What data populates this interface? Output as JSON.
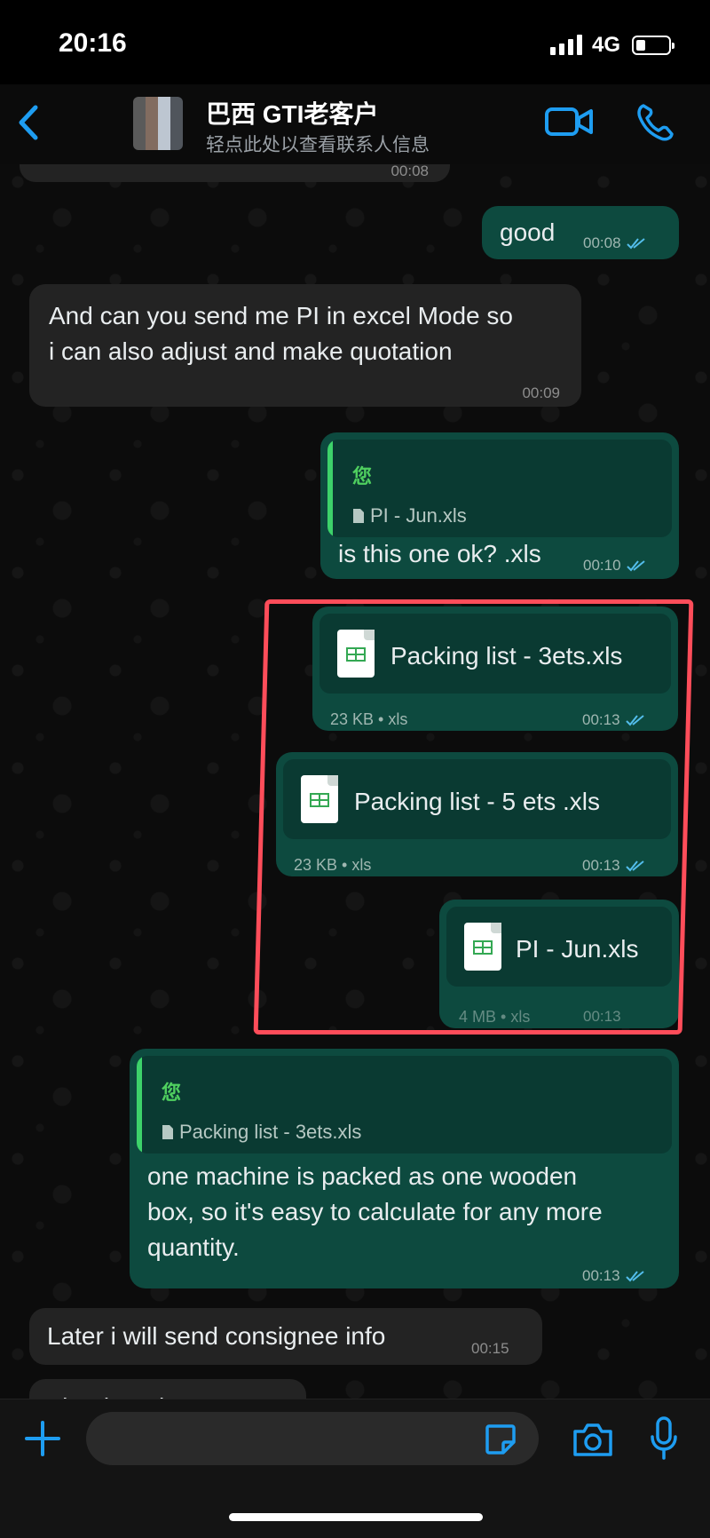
{
  "status": {
    "time": "20:16",
    "network": "4G"
  },
  "header": {
    "contact_name": "巴西 GTI老客户",
    "subtitle": "轻点此处以查看联系人信息"
  },
  "messages": {
    "m0": {
      "time": "00:08"
    },
    "m1": {
      "text": "good",
      "time": "00:08"
    },
    "m2": {
      "line1": "And can you send me PI in excel Mode so",
      "line2": "i can also adjust and make quotation",
      "time": "00:09"
    },
    "m3": {
      "quote_author": "您",
      "quote_file": "PI - Jun.xls",
      "text": "is this one ok? .xls",
      "time": "00:10"
    },
    "m4": {
      "filename": "Packing list - 3ets.xls",
      "size": "23 KB • xls",
      "time": "00:13"
    },
    "m5": {
      "filename": "Packing list - 5 ets .xls",
      "size": "23 KB • xls",
      "time": "00:13"
    },
    "m6": {
      "filename": "PI - Jun.xls",
      "size": "4 MB • xls",
      "time": "00:13"
    },
    "m7": {
      "quote_author": "您",
      "quote_file": "Packing list - 3ets.xls",
      "line1": "one machine is packed as one wooden",
      "line2": "box, so it's easy to calculate for any more",
      "line3": "quantity.",
      "time": "00:13"
    },
    "m8": {
      "text": "Later i will send consignee info",
      "time": "00:15"
    },
    "m9": {
      "text": "Thanks Ethan"
    }
  },
  "colors": {
    "accent": "#1e9df1",
    "outgoing": "#0d4a3f",
    "incoming": "#232323",
    "highlight": "#ff4d5a",
    "read_ticks": "#53bdeb"
  }
}
